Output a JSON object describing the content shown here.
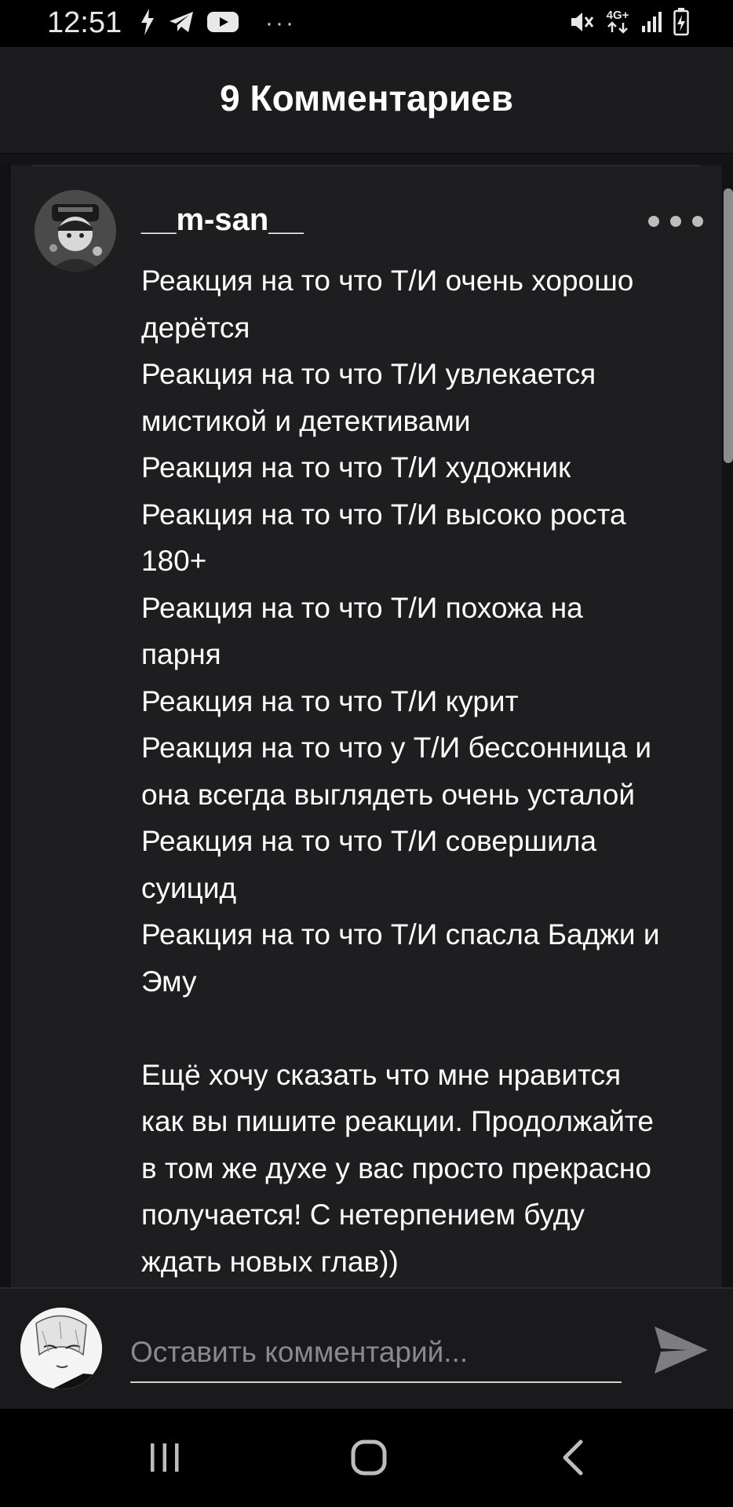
{
  "status_bar": {
    "time": "12:51",
    "left_icons": [
      "flash-icon",
      "telegram-icon",
      "youtube-icon"
    ],
    "more": "···",
    "network_label_top": "4G+",
    "right_icons": [
      "mute-icon",
      "network-4g-icon",
      "signal-icon",
      "battery-icon"
    ]
  },
  "header": {
    "title": "9 Комментариев"
  },
  "comment": {
    "author": "__m-san__",
    "text": "Реакция на то что Т/И очень хорошо\nдерётся\nРеакция на то что Т/И увлекается\nмистикой и детективами\nРеакция на то что Т/И художник\nРеакция на то что Т/И высоко роста\n180+\nРеакция на то что Т/И похожа на\nпарня\nРеакция на то что Т/И курит\nРеакция на то что у Т/И бессонница и\nона всегда выглядеть очень усталой\nРеакция на то что Т/И совершила\nсуицид\nРеакция на то что Т/И спасла Баджи и\nЭму\n\nЕщё хочу сказать что мне нравится\nкак вы пишите реакции. Продолжайте\nв том же духе у вас просто прекрасно\nполучается! С нетерпением буду\nждать новых глав))"
  },
  "input_bar": {
    "placeholder": "Оставить комментарий..."
  },
  "nav_bar": {
    "icons": [
      "recent-apps-icon",
      "home-icon",
      "back-icon"
    ]
  },
  "colors": {
    "background": "#121214",
    "card": "#1e1e20",
    "header": "#1c1c1e",
    "text": "#ffffff",
    "placeholder": "#8a8a8c"
  }
}
